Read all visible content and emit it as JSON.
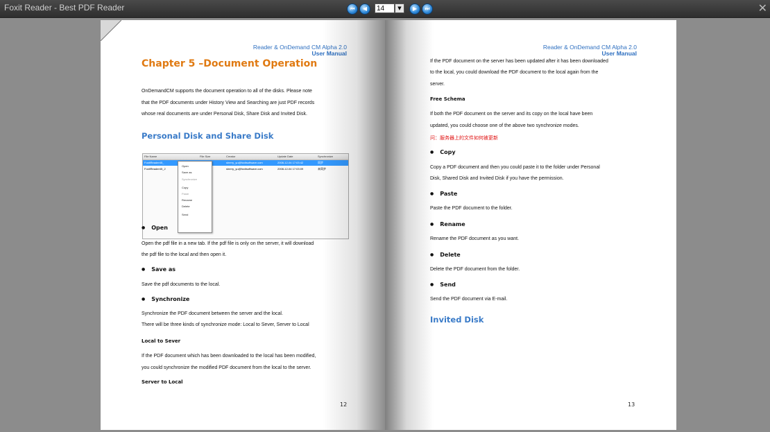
{
  "window": {
    "title": "Foxit Reader - Best PDF Reader",
    "page_number": "14",
    "close_glyph": "✕"
  },
  "nav": {
    "first": "⏮",
    "prev": "◀",
    "next": "▶",
    "last": "⏭",
    "dropdown": "▼"
  },
  "left_page": {
    "header_line1": "Reader & OnDemand CM Alpha 2.0",
    "header_line2": "User Manual",
    "chapter_title": "Chapter 5 –Document Operation",
    "intro": [
      "OnDemandCM supports the document operation to all of the disks. Please note",
      "that the PDF documents under History View and Searching are just PDF records",
      "whose real documents are under Personal Disk, Share Disk and Invited Disk."
    ],
    "section_title": "Personal Disk and Share Disk",
    "screenshot": {
      "columns": [
        "File Name",
        "File Size",
        "Creator",
        "Update Date",
        "Synchronize"
      ],
      "rows": [
        [
          "FoxitReader45_",
          "",
          "sherry_yu@foxitsoftware.com",
          "2008-12-04 17:03:42",
          "同步"
        ],
        [
          "FoxitReader45_2",
          "",
          "sherry_yu@foxitsoftware.com",
          "2008-12-04 17:03:09",
          "未同步"
        ]
      ],
      "menu": [
        "Open",
        "Save as",
        "Synchronize",
        "Copy",
        "Paste",
        "Rename",
        "Delete",
        "Send"
      ]
    },
    "open_title": "Open",
    "open_text": [
      "Open the pdf file in a new tab. If the pdf file is only on the server, it will download",
      "the pdf file to the local and then open it."
    ],
    "saveas_title": "Save as",
    "saveas_text": "Save the pdf documents to the local.",
    "sync_title": "Synchronize",
    "sync_text": [
      "Synchronize the PDF document between the server and the local.",
      "There will be three kinds of synchronize mode: Local to Sever, Server to Local"
    ],
    "l2s_title": "Local to Sever",
    "l2s_text": [
      "If the PDF document which has been downloaded to the local has been modified,",
      "you could synchronize the modified PDF document from the local to the server."
    ],
    "s2l_title": "Server to Local",
    "page_number": "12"
  },
  "right_page": {
    "header_line1": "Reader & OnDemand CM Alpha 2.0",
    "header_line2": "User Manual",
    "s2l_text": [
      "If the PDF document on the server has been updated after it has been downloaded",
      "to the local, you could download the PDF document to the local again from the",
      "server."
    ],
    "free_title": "Free Schema",
    "free_text": [
      "If both the PDF document on the server and its copy on the local have been",
      "updated, you could choose one of the above two synchronize modes."
    ],
    "red_note": "问：服务器上的文件如何被更新",
    "copy_title": "Copy",
    "copy_text": [
      "Copy a PDF document and then you could paste it to the folder under Personal",
      "Disk, Shared Disk and Invited Disk if you have the permission."
    ],
    "paste_title": "Paste",
    "paste_text": "Paste the PDF document to the folder.",
    "rename_title": "Rename",
    "rename_text": "Rename the PDF document as you want.",
    "delete_title": "Delete",
    "delete_text": "Delete the PDF document from the folder.",
    "send_title": "Send",
    "send_text": "Send the PDF document via E-mail.",
    "invited_title": "Invited Disk",
    "page_number": "13"
  }
}
